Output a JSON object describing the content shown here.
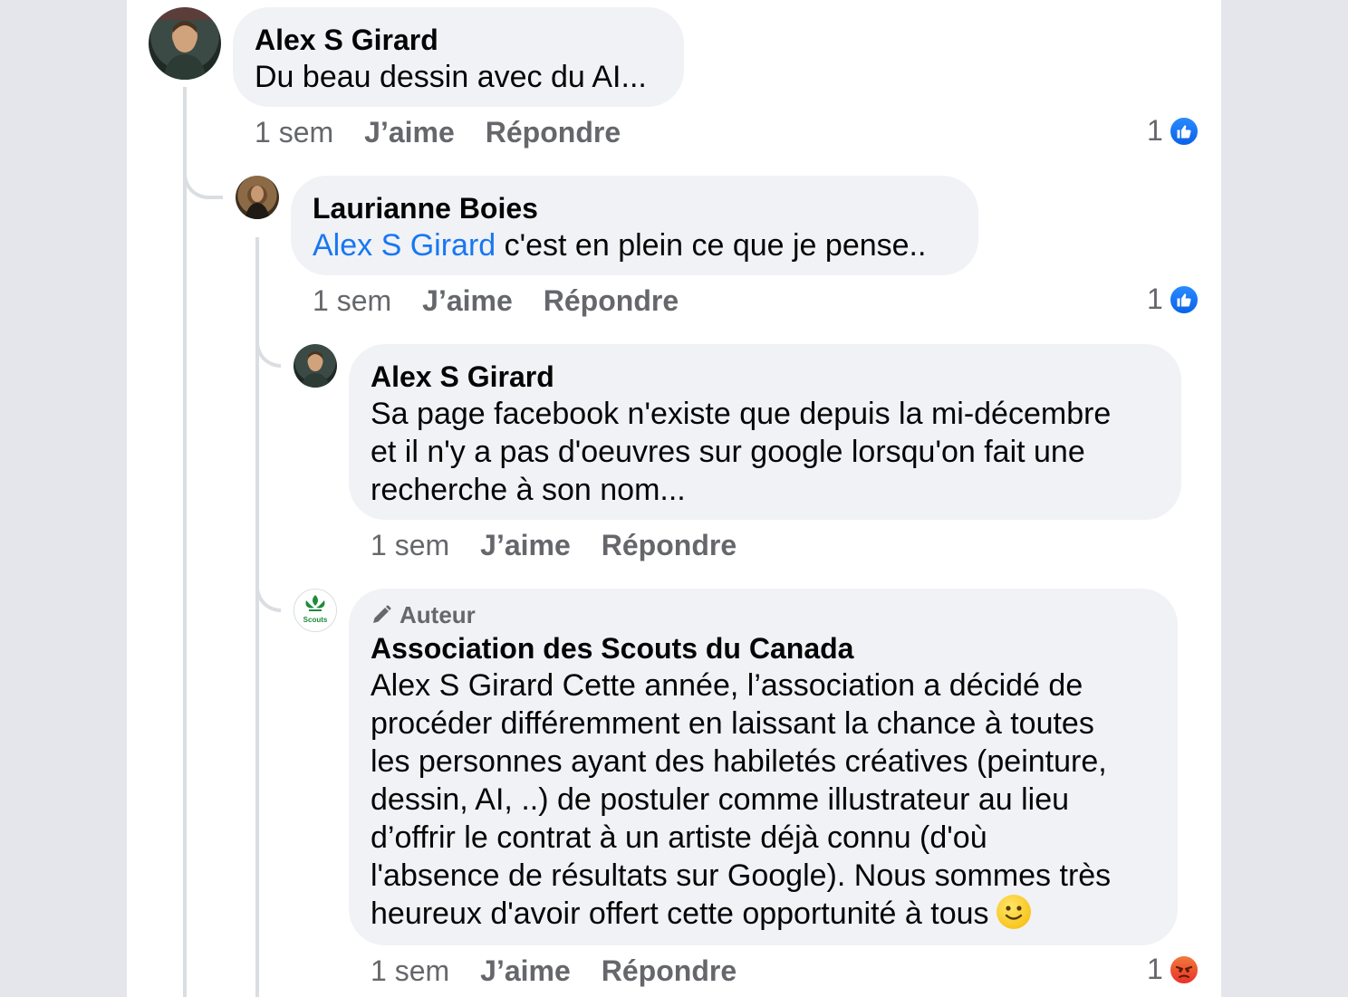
{
  "comments": [
    {
      "author": "Alex S Girard",
      "text": "Du beau dessin avec du AI...",
      "time": "1 sem",
      "like_label": "J’aime",
      "reply_label": "Répondre",
      "reaction_count": "1",
      "reaction_icon": "like-icon"
    },
    {
      "author": "Laurianne Boies",
      "mention": "Alex S Girard",
      "text": " c'est en plein ce que je pense..",
      "time": "1 sem",
      "like_label": "J’aime",
      "reply_label": "Répondre",
      "reaction_count": "1",
      "reaction_icon": "like-icon"
    },
    {
      "author": "Alex S Girard",
      "text_lines": [
        "Sa page facebook n'existe que depuis la mi-décembre",
        "et il n'y a pas d'oeuvres sur google lorsqu'on fait une",
        "recherche à son nom..."
      ],
      "time": "1 sem",
      "like_label": "J’aime",
      "reply_label": "Répondre"
    },
    {
      "badge": "Auteur",
      "author": "Association des Scouts du Canada",
      "avatar_label": "Scouts",
      "text_lines": [
        "Alex S Girard Cette année, l’association a décidé de",
        "procéder différemment en laissant la chance à toutes",
        "les personnes ayant des habiletés créatives (peinture,",
        "dessin, AI, ..) de postuler comme illustrateur au lieu",
        "d’offrir le contrat à un artiste déjà connu (d'où",
        "l'absence de résultats sur Google). Nous sommes très",
        "heureux d'avoir offert cette opportunité à tous"
      ],
      "emoji": "slightly-smiling-face-icon",
      "time": "1 sem",
      "like_label": "J’aime",
      "reply_label": "Répondre",
      "reaction_count": "1",
      "reaction_icon": "angry-icon"
    }
  ],
  "colors": {
    "bubble": "#f0f2f5",
    "mention": "#1877f2",
    "meta": "#65676b",
    "like": "#1877f2",
    "angry": "#e8302a"
  }
}
